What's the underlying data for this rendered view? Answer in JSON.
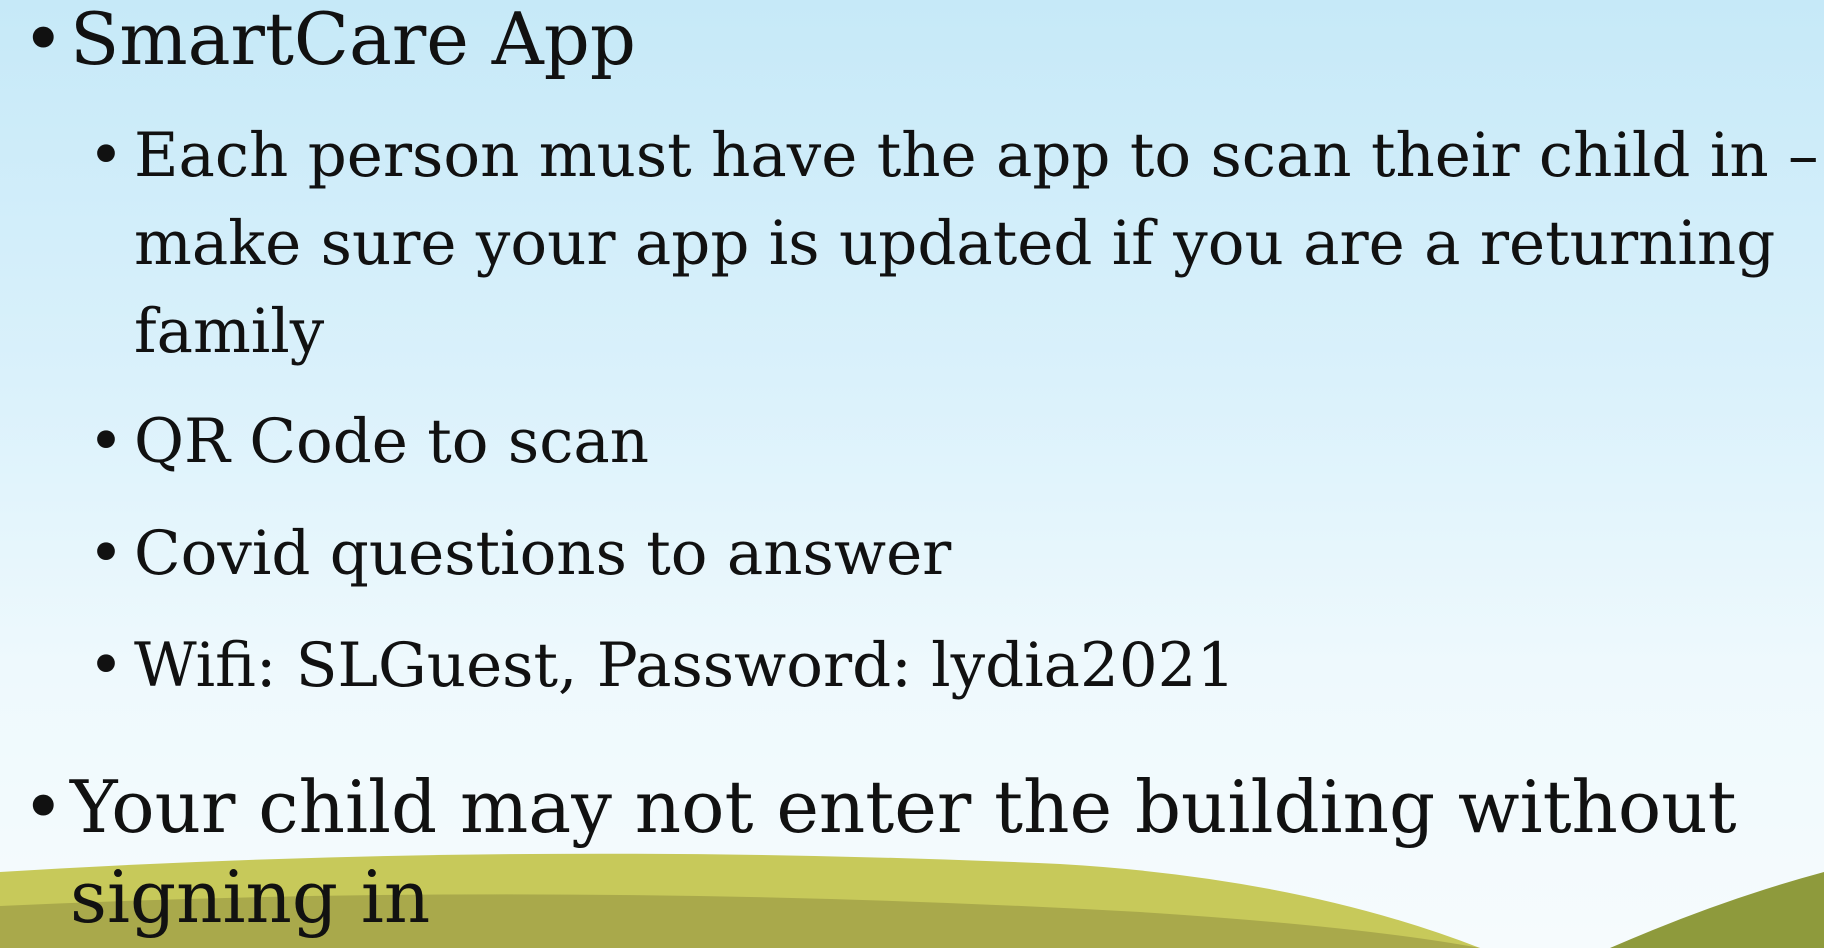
{
  "slide": {
    "items": [
      {
        "level": 1,
        "text": "SmartCare App"
      },
      {
        "level": 2,
        "text": "Each person must have the app to scan their child in – make sure your app is updated if you are a returning family"
      },
      {
        "level": 2,
        "text": "QR Code to scan"
      },
      {
        "level": 2,
        "text": "Covid questions to answer"
      },
      {
        "level": 2,
        "text": "Wifi: SLGuest, Password: lydia2021"
      },
      {
        "level": 1,
        "text": "Your child may not enter the building without signing in"
      }
    ],
    "bullet_glyph": "•",
    "colors": {
      "sky_top": "#c6e9f8",
      "sky_bottom": "#f6fbfd",
      "hill_light": "#c7c95a",
      "hill_dark": "#a9a94b",
      "hill_right": "#8e9a3c",
      "text": "#111111"
    }
  }
}
